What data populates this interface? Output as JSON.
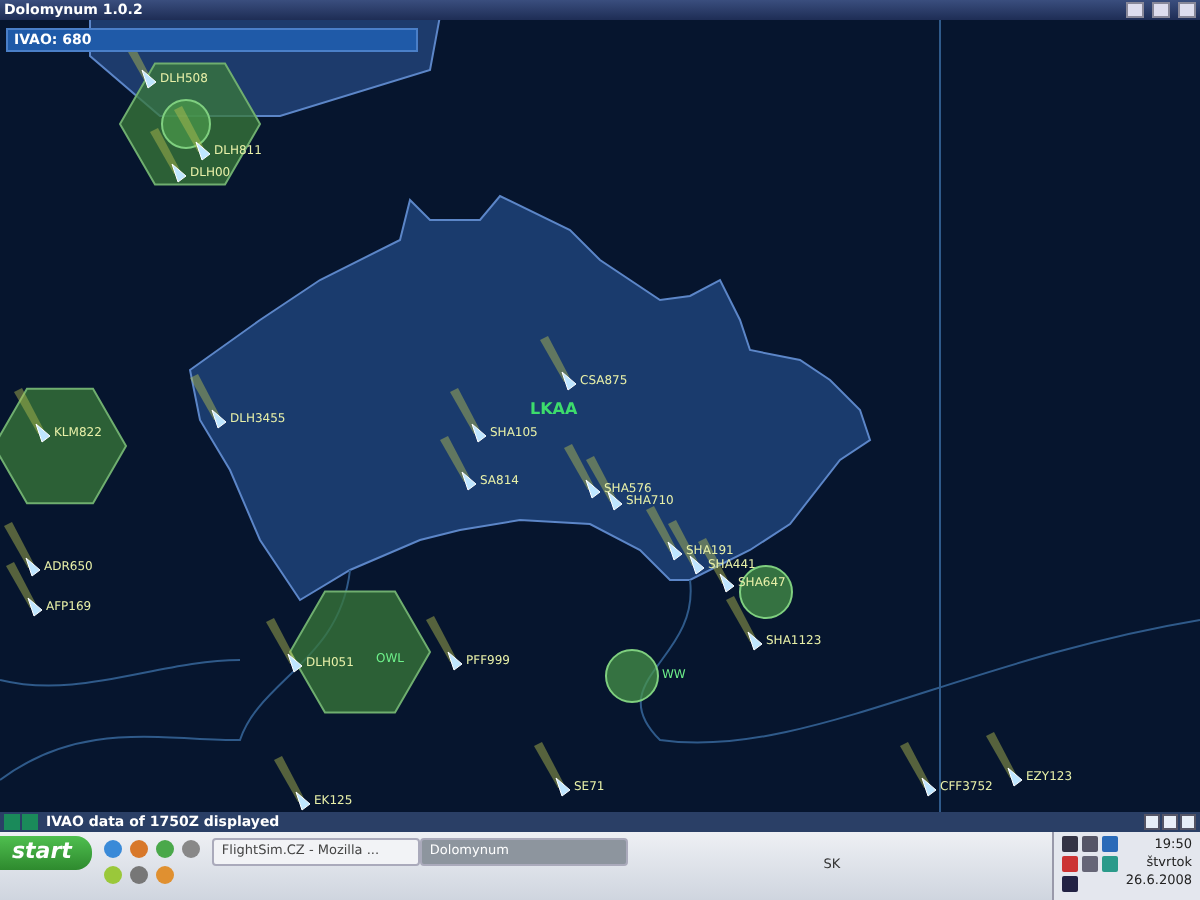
{
  "window": {
    "title": "Dolomynum 1.0.2"
  },
  "counter": {
    "label": "IVAO: 680"
  },
  "map": {
    "sector": {
      "label": "LKAA"
    },
    "stations": [
      {
        "label": "OWL"
      },
      {
        "label": "WW"
      }
    ],
    "aircraft": [
      {
        "callsign": "DLH508"
      },
      {
        "callsign": "DLH811"
      },
      {
        "callsign": "DLH00"
      },
      {
        "callsign": "KLM822"
      },
      {
        "callsign": "DLH3455"
      },
      {
        "callsign": "SHA105"
      },
      {
        "callsign": "SA814"
      },
      {
        "callsign": "CSA875"
      },
      {
        "callsign": "SHA576"
      },
      {
        "callsign": "SHA710"
      },
      {
        "callsign": "SHA191"
      },
      {
        "callsign": "SHA441"
      },
      {
        "callsign": "SHA647"
      },
      {
        "callsign": "SHA1123"
      },
      {
        "callsign": "ADR650"
      },
      {
        "callsign": "AFP169"
      },
      {
        "callsign": "DLH051"
      },
      {
        "callsign": "PFF999"
      },
      {
        "callsign": "EK125"
      },
      {
        "callsign": "SE71"
      },
      {
        "callsign": "CFF3752"
      },
      {
        "callsign": "EZY123"
      }
    ]
  },
  "status_bar": {
    "text": "IVAO data of 1750Z displayed"
  },
  "taskbar": {
    "start": "start",
    "tasks": [
      {
        "label": "FlightSim.CZ - Mozilla ...",
        "selected": false
      },
      {
        "label": "Dolomynum",
        "selected": true
      }
    ],
    "language": "SK",
    "time": "19:50",
    "day": "štvrtok",
    "date": "26.6.2008"
  }
}
